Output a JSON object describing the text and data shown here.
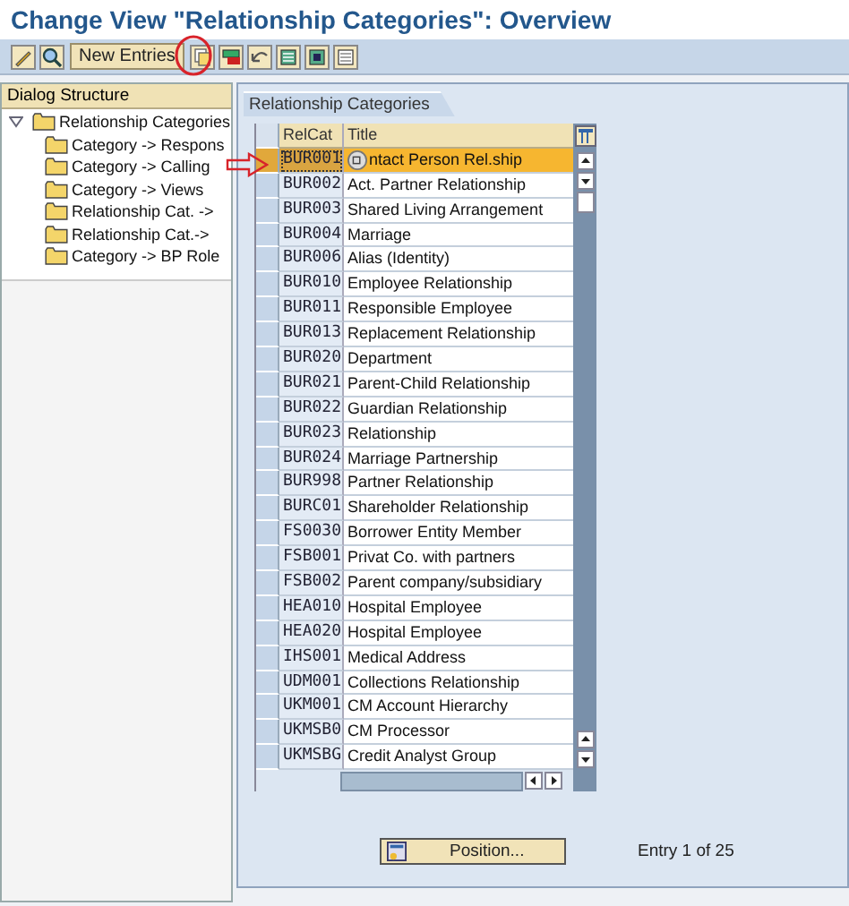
{
  "window": {
    "title": "Change View \"Relationship Categories\": Overview"
  },
  "toolbar": {
    "new_entries_button": "New Entries"
  },
  "dialog_structure": {
    "title": "Dialog Structure",
    "tree": [
      {
        "label": "Relationship Categories",
        "expanded": true,
        "children": [
          {
            "label": "Category -> Respons"
          },
          {
            "label": "Category -> Calling"
          },
          {
            "label": "Category -> Views"
          },
          {
            "label": "Relationship Cat. ->"
          },
          {
            "label": "Relationship Cat.->"
          },
          {
            "label": "Category -> BP Role"
          }
        ]
      }
    ]
  },
  "table": {
    "tab": "Relationship Categories",
    "columns": [
      "RelCat",
      "Title"
    ],
    "rows": [
      {
        "relcat": "BUR001",
        "title": "ntact Person Rel.ship",
        "selected": true,
        "pointer_icon": true
      },
      {
        "relcat": "BUR002",
        "title": "Act. Partner Relationship",
        "selected": false
      },
      {
        "relcat": "BUR003",
        "title": "Shared Living Arrangement",
        "selected": false
      },
      {
        "relcat": "BUR004",
        "title": "Marriage",
        "selected": false
      },
      {
        "relcat": "BUR006",
        "title": "Alias (Identity)",
        "selected": false
      },
      {
        "relcat": "BUR010",
        "title": "Employee Relationship",
        "selected": false
      },
      {
        "relcat": "BUR011",
        "title": "Responsible Employee",
        "selected": false
      },
      {
        "relcat": "BUR013",
        "title": "Replacement Relationship",
        "selected": false
      },
      {
        "relcat": "BUR020",
        "title": "Department",
        "selected": false
      },
      {
        "relcat": "BUR021",
        "title": "Parent-Child Relationship",
        "selected": false
      },
      {
        "relcat": "BUR022",
        "title": "Guardian Relationship",
        "selected": false
      },
      {
        "relcat": "BUR023",
        "title": "Relationship",
        "selected": false
      },
      {
        "relcat": "BUR024",
        "title": "Marriage Partnership",
        "selected": false
      },
      {
        "relcat": "BUR998",
        "title": "Partner Relationship",
        "selected": false
      },
      {
        "relcat": "BURC01",
        "title": "Shareholder Relationship",
        "selected": false
      },
      {
        "relcat": "FS0030",
        "title": "Borrower Entity Member",
        "selected": false
      },
      {
        "relcat": "FSB001",
        "title": "Privat Co. with partners",
        "selected": false
      },
      {
        "relcat": "FSB002",
        "title": "Parent company/subsidiary",
        "selected": false
      },
      {
        "relcat": "HEA010",
        "title": "Hospital Employee",
        "selected": false
      },
      {
        "relcat": "HEA020",
        "title": "Hospital Employee",
        "selected": false
      },
      {
        "relcat": "IHS001",
        "title": "Medical Address",
        "selected": false
      },
      {
        "relcat": "UDM001",
        "title": "Collections Relationship",
        "selected": false
      },
      {
        "relcat": "UKM001",
        "title": "CM Account Hierarchy",
        "selected": false
      },
      {
        "relcat": "UKMSB0",
        "title": "CM Processor",
        "selected": false
      },
      {
        "relcat": "UKMSBG",
        "title": "Credit Analyst Group",
        "selected": false
      }
    ]
  },
  "footer": {
    "position_button": "Position...",
    "entry_info": "Entry 1 of 25"
  }
}
